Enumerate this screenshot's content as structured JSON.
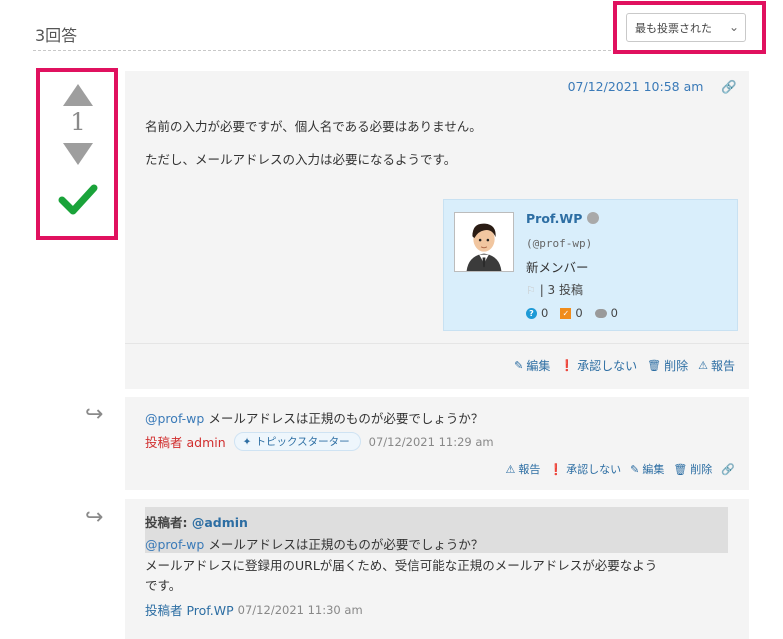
{
  "header": {
    "answers_count": "3回答",
    "sort_selected": "最も投票された"
  },
  "answer": {
    "vote_count": "1",
    "date": "07/12/2021 10:58 am",
    "paragraphs": [
      "名前の入力が必要ですが、個人名である必要はありません。",
      "ただし、メールアドレスの入力は必要になるようです。"
    ],
    "author": {
      "name": "Prof.WP",
      "handle": "(@prof-wp)",
      "rank": "新メンバー",
      "posts": "| 3 投稿",
      "questions": "0",
      "answers": "0",
      "comments": "0"
    },
    "actions": [
      "編集",
      "承認しない",
      "削除",
      "報告"
    ]
  },
  "comments": [
    {
      "mention": "@prof-wp",
      "text": " メールアドレスは正規のものが必要でしょうか？",
      "poster_label": "投稿者 admin",
      "badge": "トピックスターター",
      "date": "07/12/2021 11:29 am",
      "actions": [
        "報告",
        "承認しない",
        "編集",
        "削除"
      ]
    },
    {
      "quote_label": "投稿者: ",
      "quote_author": "@admin",
      "quote_mention": "@prof-wp",
      "quote_text": " メールアドレスは正規のものが必要でしょうか？",
      "body_line1": "メールアドレスに登録用のURLが届くため、受信可能な正規のメールアドレスが必要なよう",
      "body_line2": "です。",
      "poster_label": "投稿者 Prof.WP",
      "date": "07/12/2021 11:30 am"
    }
  ]
}
